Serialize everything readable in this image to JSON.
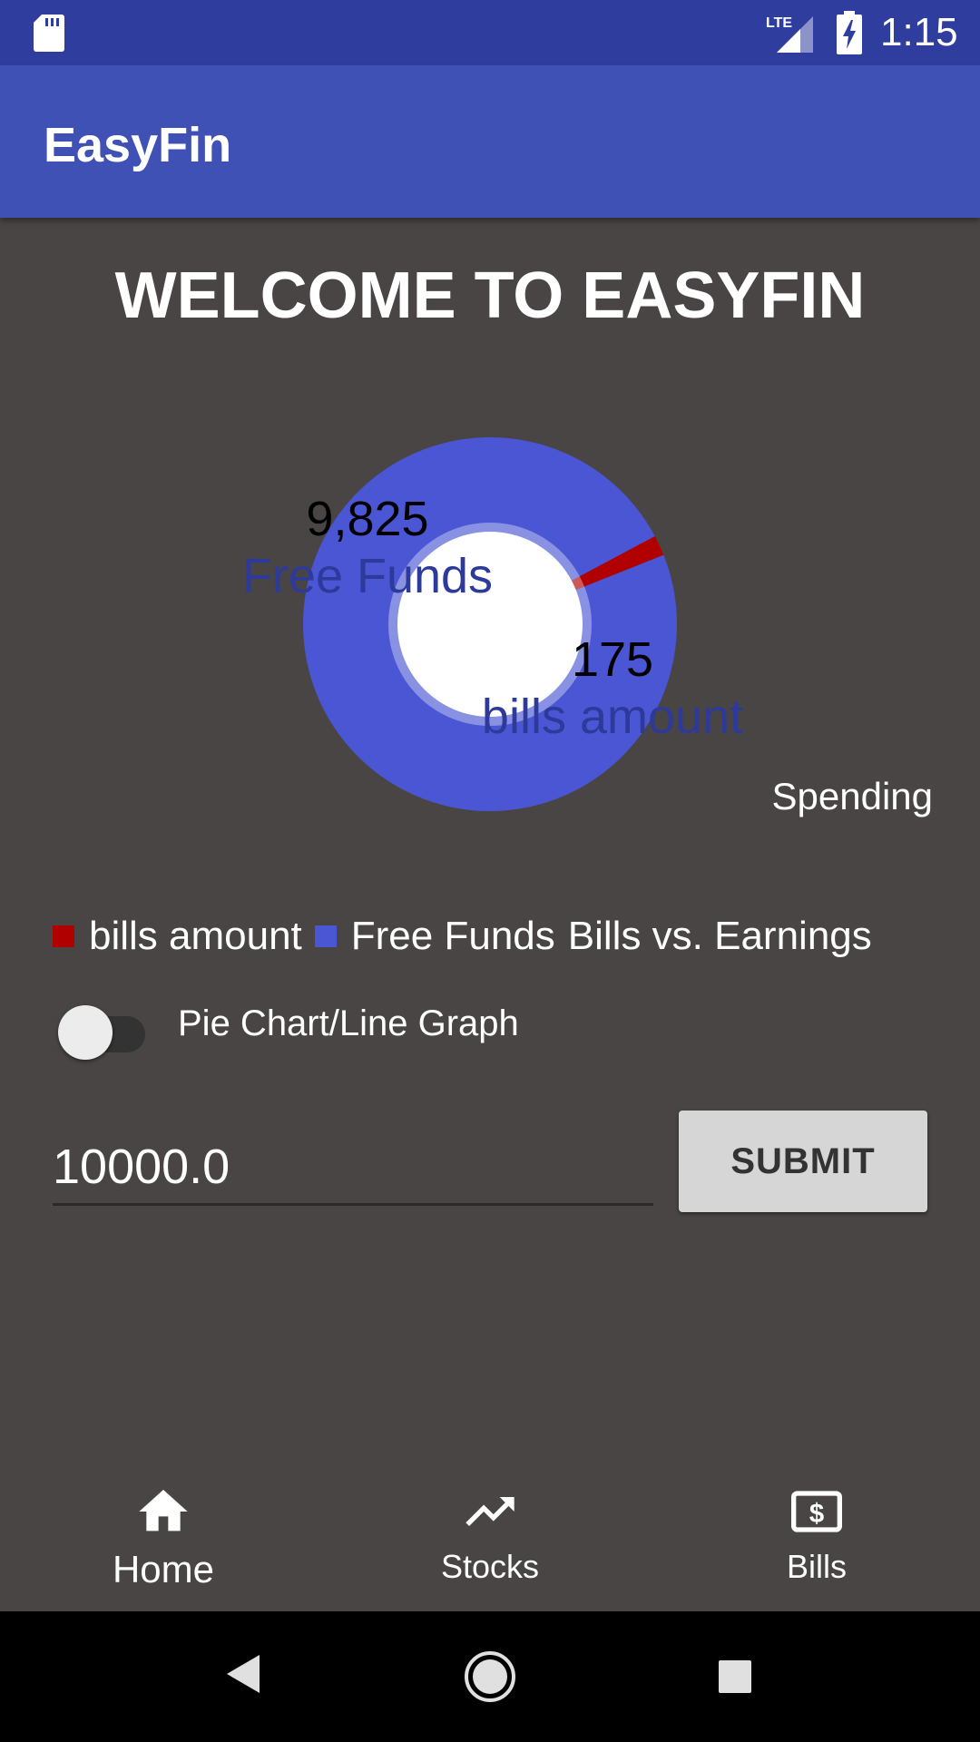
{
  "status_bar": {
    "time": "1:15",
    "network": "LTE",
    "icons": [
      "sd-card-icon",
      "lte-signal-icon",
      "battery-charging-icon"
    ]
  },
  "app_bar": {
    "title": "EasyFin"
  },
  "welcome": {
    "heading": "WELCOME TO EASYFIN"
  },
  "chart_data": {
    "type": "pie",
    "title": "",
    "description": "Bills vs. Earnings",
    "center_text": "Spending",
    "slices": [
      {
        "label": "Free Funds",
        "value": 9825,
        "value_label": "9,825",
        "color": "#4a56d4"
      },
      {
        "label": "bills amount",
        "value": 175,
        "value_label": "175",
        "color": "#b00000"
      }
    ],
    "legend": [
      {
        "label": "bills amount",
        "color": "#b00000"
      },
      {
        "label": "Free Funds",
        "color": "#4a56d4"
      }
    ],
    "legend_placement": "bottom-left"
  },
  "controls": {
    "toggle_label": "Pie Chart/Line Graph",
    "toggle_on": false,
    "amount_value": "10000.0",
    "submit_label": "SUBMIT"
  },
  "bottom_nav": {
    "items": [
      {
        "label": "Home",
        "icon": "home-icon",
        "active": true
      },
      {
        "label": "Stocks",
        "icon": "trending-up-icon",
        "active": false
      },
      {
        "label": "Bills",
        "icon": "dollar-bill-icon",
        "active": false
      }
    ]
  },
  "system_nav": {
    "buttons": [
      "back-icon",
      "home-circle-icon",
      "recents-icon"
    ]
  },
  "colors": {
    "status_bar": "#2f3e9e",
    "app_bar": "#3f51b5",
    "background": "#494545",
    "free_funds": "#4a56d4",
    "bills": "#b00000"
  }
}
